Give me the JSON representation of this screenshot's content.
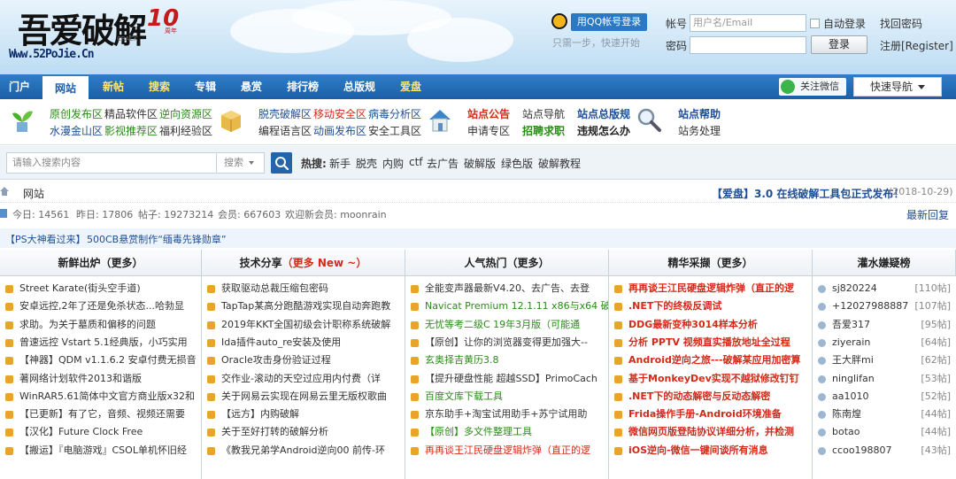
{
  "header": {
    "logo_cn": "吾爱破解",
    "logo_crack": "CRACK",
    "logo_badge": "10",
    "logo_badge_sub": "周年",
    "logo_url": "Www.52PoJie.Cn",
    "qq_login": "用QQ帐号登录",
    "qq_hint": "只需一步，快速开始",
    "account_label": "帐号",
    "account_placeholder": "用户名/Email",
    "remember_label": "自动登录",
    "find_password": "找回密码",
    "password_label": "密码",
    "login_button": "登录",
    "register": "注册[Register]"
  },
  "nav": {
    "items": [
      "门户",
      "网站",
      "新帖",
      "搜索",
      "专辑",
      "悬赏",
      "排行榜",
      "总版规",
      "爱盘"
    ],
    "active": "网站",
    "wechat": "关注微信",
    "quick_nav": "快速导航"
  },
  "quick_links": {
    "group1": [
      [
        "原创发布区",
        "精品软件区",
        "逆向资源区"
      ],
      [
        "水漫金山区",
        "影视推荐区",
        "福利经验区"
      ]
    ],
    "group2": [
      [
        "脱壳破解区",
        "移动安全区",
        "病毒分析区"
      ],
      [
        "编程语言区",
        "动画发布区",
        "安全工具区"
      ]
    ],
    "group3": [
      [
        "站点公告",
        "站点导航",
        "站点总版规"
      ],
      [
        "申请专区",
        "招聘求职",
        "违规怎么办"
      ]
    ],
    "group4": [
      [
        "站点帮助"
      ],
      [
        "站务处理"
      ]
    ]
  },
  "search": {
    "placeholder": "请输入搜索内容",
    "select": "搜索",
    "hot_label": "热搜:",
    "hot_terms": [
      "新手",
      "脱壳",
      "内购",
      "ctf",
      "去广告",
      "破解版",
      "绿色版",
      "破解教程"
    ]
  },
  "breadcrumb": {
    "current": "网站",
    "announcement": "【爱盘】3.0 在线破解工具包正式发布！",
    "announcement_date": "(2018-10-29)"
  },
  "stats": {
    "today": "今日: 14561",
    "yesterday": "昨日: 17806",
    "posts": "帖子: 19273214",
    "members": "会员: 667603",
    "welcome": "欢迎新会员: moonrain",
    "latest_reply": "最新回复"
  },
  "notice": {
    "left": "【PS大神看过来】",
    "right": "500CB悬赏制作“缅毒先锋勋章”"
  },
  "columns": [
    {
      "title": "新鲜出炉（更多）",
      "items": [
        "Street Karate(街头空手道)",
        "安卓远控,2年了还是免杀状态...哈勃显",
        "求助。为关于墓质和偏移的问题",
        "曾速远控 Vstart 5.1经典版，小巧实用",
        "【神器】QDM v1.1.6.2 安卓付费无损音",
        "著网络计划软件2013和谐版",
        "WinRAR5.61简体中文官方商业版x32和",
        "【已更新】有了它，音频、视频还需要",
        "【汉化】Future Clock Free",
        "【搬运】『电脑游戏』CSOL单机怀旧经"
      ]
    },
    {
      "title": "技术分享",
      "title_more": "（更多 New ~）",
      "items": [
        "获取驱动总裁压缩包密码",
        "TapTap某高分跑酷游戏实现自动奔跑教",
        "2019年KKT全国初级会计职称系统破解",
        "Ida插件auto_re安装及使用",
        "Oracle攻击身份验证过程",
        "交作业-滚动的天空过应用内付费（详",
        "关于网易云实现在网易云里无版权歌曲",
        "【远方】内购破解",
        "关于至好打转的破解分析",
        "《教我兄弟学Android逆向00 前传-环"
      ]
    },
    {
      "title": "人气热门（更多）",
      "items": [
        "全能变声器最新V4.20、去广告、去登",
        "Navicat Premium 12.1.11 x86与x64 破",
        "无忧等考二级C 19年3月版（可能通",
        "【原创】让你的浏览器变得更加强大--",
        "玄奥择吉黄历3.8",
        "【提升硬盘性能 超越SSD】PrimoCach",
        "百度文库下载工具",
        "京东助手+淘宝试用助手+苏宁试用助",
        "【原创】多文件整理工具",
        "再再谈王江民硬盘逻辑炸弹（直正的逻"
      ]
    },
    {
      "title": "精华采撷（更多）",
      "items": [
        "再再谈王江民硬盘逻辑炸弹（直正的逻",
        ".NET下的终极反调试",
        "DDG最新变种3014样本分析",
        "分析 PPTV 视频直实播放地址全过程",
        "Android逆向之旅---破解某应用加密算",
        "基于MonkeyDev实现不越狱修改钉钉",
        ".NET下的动态解密与反动态解密",
        "Frida操作手册-Android环境准备",
        "微信网页版登陆协议详细分析，并检测",
        "iOS逆向-微信一键间谈所有消息"
      ]
    },
    {
      "title": "灌水嫌疑榜",
      "items": [
        [
          "sj820224",
          "[110帖]"
        ],
        [
          "+12027988887",
          "[107帖]"
        ],
        [
          "吾爱317",
          "[95帖]"
        ],
        [
          "ziyerain",
          "[64帖]"
        ],
        [
          "王大胖mi",
          "[62帖]"
        ],
        [
          "ninglifan",
          "[53帖]"
        ],
        [
          "aa1010",
          "[52帖]"
        ],
        [
          "陈南煌",
          "[44帖]"
        ],
        [
          "botao",
          "[44帖]"
        ],
        [
          "ccoo198807",
          "[43帖]"
        ]
      ]
    }
  ],
  "colors": {
    "nav_blue": "#1c5fa7",
    "accent_red": "#d42a1a",
    "accent_green": "#2a8a18",
    "link_blue": "#1e4f95"
  },
  "icons": [
    "plant-icon",
    "box-icon",
    "house-icon",
    "magnifier-icon",
    "search-icon",
    "qq-icon",
    "wechat-icon",
    "home-icon"
  ]
}
